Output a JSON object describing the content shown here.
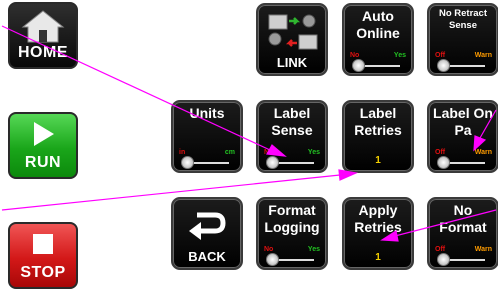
{
  "side": {
    "home_label": "HOME",
    "run_label": "RUN",
    "stop_label": "STOP"
  },
  "tiles": {
    "link": {
      "label": "LINK"
    },
    "auto_online": {
      "title": "Auto Online",
      "left": "No",
      "right": "Yes"
    },
    "no_retract_sense": {
      "title": "No Retract Sense",
      "left": "Off",
      "right": "Warn"
    },
    "units": {
      "title": "Units",
      "left": "in",
      "right": "cm"
    },
    "label_sense": {
      "title": "Label Sense",
      "left": "No",
      "right": "Yes"
    },
    "label_retries": {
      "title": "Label Retries",
      "value": "1"
    },
    "label_on_pad": {
      "title": "Label On Pa",
      "left": "Off",
      "right": "Warn"
    },
    "back": {
      "label": "BACK"
    },
    "format_logging": {
      "title": "Format Logging",
      "left": "No",
      "right": "Yes"
    },
    "apply_retries": {
      "title": "Apply Retries",
      "value": "1"
    },
    "no_format": {
      "title": "No Format",
      "left": "Off",
      "right": "Warn"
    }
  },
  "colors": {
    "tile_bg": "#000000",
    "value_yellow": "#f4d000",
    "no_red": "#e01010",
    "yes_green": "#22c022",
    "warn_orange": "#ff9c00",
    "run_green": "#1aa61a",
    "stop_red": "#d31818",
    "callout_magenta": "#ff00ff"
  }
}
